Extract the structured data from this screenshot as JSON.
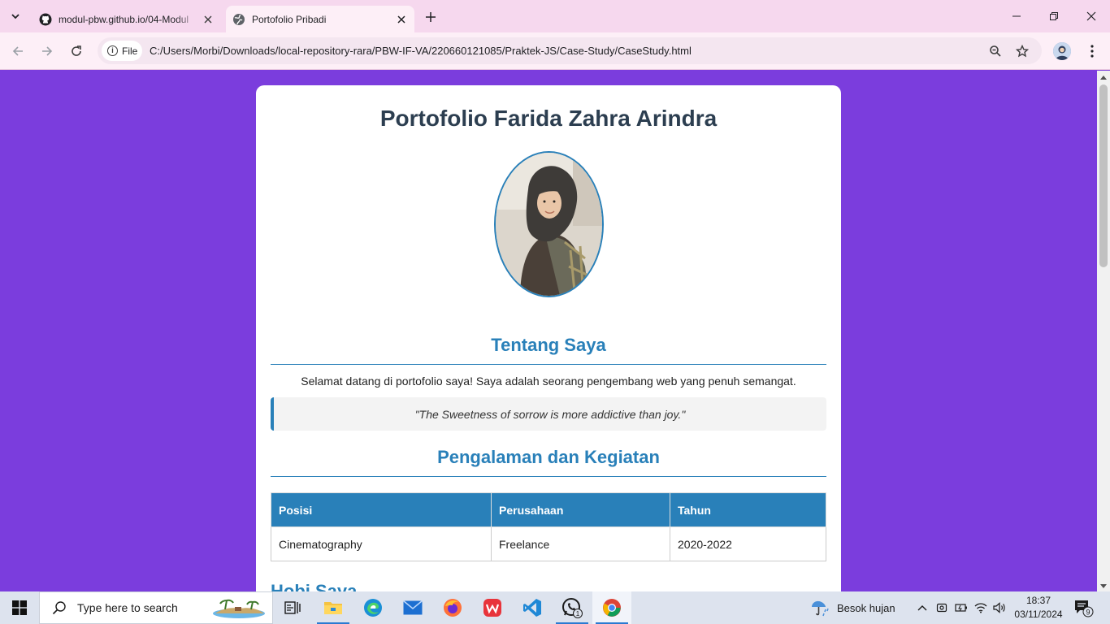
{
  "browser": {
    "tabs": [
      {
        "title": "modul-pbw.github.io/04-Modul",
        "icon": "github-icon",
        "active": false
      },
      {
        "title": "Portofolio Pribadi",
        "icon": "globe-icon",
        "active": true
      }
    ],
    "security_chip": "File",
    "url": "C:/Users/Morbi/Downloads/local-repository-rara/PBW-IF-VA/220660121085/Praktek-JS/Case-Study/CaseStudy.html"
  },
  "page": {
    "title": "Portofolio Farida Zahra Arindra",
    "about": {
      "heading": "Tentang Saya",
      "text": "Selamat datang di portofolio saya! Saya adalah seorang pengembang web yang penuh semangat.",
      "quote": "\"The Sweetness of sorrow is more addictive than joy.\""
    },
    "experience": {
      "heading": "Pengalaman dan Kegiatan",
      "columns": [
        "Posisi",
        "Perusahaan",
        "Tahun"
      ],
      "rows": [
        [
          "Cinematography",
          "Freelance",
          "2020-2022"
        ]
      ]
    },
    "hobby_heading": "Hobi Saya"
  },
  "taskbar": {
    "search_placeholder": "Type here to search",
    "weather": "Besok hujan",
    "time": "18:37",
    "date": "03/11/2024",
    "notification_count": "9",
    "whatsapp_badge": "1"
  },
  "colors": {
    "page_background": "#7b3ddd",
    "accent": "#2980b9",
    "heading": "#2c3e50"
  }
}
